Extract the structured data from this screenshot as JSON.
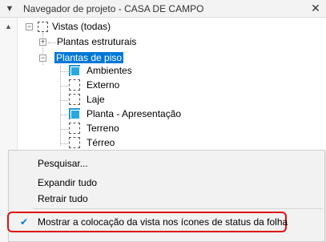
{
  "window": {
    "title": "Navegador de projeto - CASA DE CAMPO",
    "close_symbol": "✕",
    "collapse_symbol": "▼"
  },
  "tree": {
    "root": {
      "label": "Vistas (todas)"
    },
    "groups": [
      {
        "label": "Plantas estruturais",
        "expanded": false
      },
      {
        "label": "Plantas de piso",
        "expanded": true,
        "selected": true
      }
    ],
    "views": [
      {
        "label": "Ambientes",
        "placed_on_sheet": true
      },
      {
        "label": "Externo",
        "placed_on_sheet": false
      },
      {
        "label": "Laje",
        "placed_on_sheet": false
      },
      {
        "label": "Planta - Apresentação",
        "placed_on_sheet": true
      },
      {
        "label": "Terreno",
        "placed_on_sheet": false
      },
      {
        "label": "Térreo",
        "placed_on_sheet": false
      }
    ]
  },
  "context_menu": {
    "items": [
      {
        "label": "Pesquisar..."
      },
      {
        "label": "Expandir tudo"
      },
      {
        "label": "Retrair tudo"
      },
      {
        "label": "Mostrar a colocação da vista nos ícones de status da folha",
        "checked": true
      }
    ]
  },
  "colors": {
    "selection": "#0078d7",
    "placed_icon": "#2aa8e0",
    "menu_highlight_box": "#e01010"
  }
}
